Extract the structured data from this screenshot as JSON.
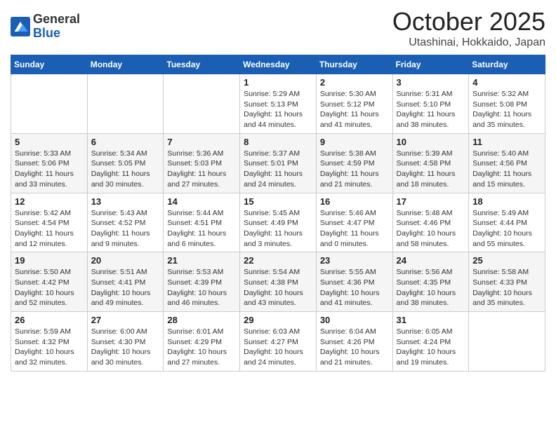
{
  "logo": {
    "general": "General",
    "blue": "Blue"
  },
  "title": "October 2025",
  "subtitle": "Utashinai, Hokkaido, Japan",
  "days_of_week": [
    "Sunday",
    "Monday",
    "Tuesday",
    "Wednesday",
    "Thursday",
    "Friday",
    "Saturday"
  ],
  "weeks": [
    [
      {
        "day": "",
        "info": ""
      },
      {
        "day": "",
        "info": ""
      },
      {
        "day": "",
        "info": ""
      },
      {
        "day": "1",
        "info": "Sunrise: 5:29 AM\nSunset: 5:13 PM\nDaylight: 11 hours\nand 44 minutes."
      },
      {
        "day": "2",
        "info": "Sunrise: 5:30 AM\nSunset: 5:12 PM\nDaylight: 11 hours\nand 41 minutes."
      },
      {
        "day": "3",
        "info": "Sunrise: 5:31 AM\nSunset: 5:10 PM\nDaylight: 11 hours\nand 38 minutes."
      },
      {
        "day": "4",
        "info": "Sunrise: 5:32 AM\nSunset: 5:08 PM\nDaylight: 11 hours\nand 35 minutes."
      }
    ],
    [
      {
        "day": "5",
        "info": "Sunrise: 5:33 AM\nSunset: 5:06 PM\nDaylight: 11 hours\nand 33 minutes."
      },
      {
        "day": "6",
        "info": "Sunrise: 5:34 AM\nSunset: 5:05 PM\nDaylight: 11 hours\nand 30 minutes."
      },
      {
        "day": "7",
        "info": "Sunrise: 5:36 AM\nSunset: 5:03 PM\nDaylight: 11 hours\nand 27 minutes."
      },
      {
        "day": "8",
        "info": "Sunrise: 5:37 AM\nSunset: 5:01 PM\nDaylight: 11 hours\nand 24 minutes."
      },
      {
        "day": "9",
        "info": "Sunrise: 5:38 AM\nSunset: 4:59 PM\nDaylight: 11 hours\nand 21 minutes."
      },
      {
        "day": "10",
        "info": "Sunrise: 5:39 AM\nSunset: 4:58 PM\nDaylight: 11 hours\nand 18 minutes."
      },
      {
        "day": "11",
        "info": "Sunrise: 5:40 AM\nSunset: 4:56 PM\nDaylight: 11 hours\nand 15 minutes."
      }
    ],
    [
      {
        "day": "12",
        "info": "Sunrise: 5:42 AM\nSunset: 4:54 PM\nDaylight: 11 hours\nand 12 minutes."
      },
      {
        "day": "13",
        "info": "Sunrise: 5:43 AM\nSunset: 4:52 PM\nDaylight: 11 hours\nand 9 minutes."
      },
      {
        "day": "14",
        "info": "Sunrise: 5:44 AM\nSunset: 4:51 PM\nDaylight: 11 hours\nand 6 minutes."
      },
      {
        "day": "15",
        "info": "Sunrise: 5:45 AM\nSunset: 4:49 PM\nDaylight: 11 hours\nand 3 minutes."
      },
      {
        "day": "16",
        "info": "Sunrise: 5:46 AM\nSunset: 4:47 PM\nDaylight: 11 hours\nand 0 minutes."
      },
      {
        "day": "17",
        "info": "Sunrise: 5:48 AM\nSunset: 4:46 PM\nDaylight: 10 hours\nand 58 minutes."
      },
      {
        "day": "18",
        "info": "Sunrise: 5:49 AM\nSunset: 4:44 PM\nDaylight: 10 hours\nand 55 minutes."
      }
    ],
    [
      {
        "day": "19",
        "info": "Sunrise: 5:50 AM\nSunset: 4:42 PM\nDaylight: 10 hours\nand 52 minutes."
      },
      {
        "day": "20",
        "info": "Sunrise: 5:51 AM\nSunset: 4:41 PM\nDaylight: 10 hours\nand 49 minutes."
      },
      {
        "day": "21",
        "info": "Sunrise: 5:53 AM\nSunset: 4:39 PM\nDaylight: 10 hours\nand 46 minutes."
      },
      {
        "day": "22",
        "info": "Sunrise: 5:54 AM\nSunset: 4:38 PM\nDaylight: 10 hours\nand 43 minutes."
      },
      {
        "day": "23",
        "info": "Sunrise: 5:55 AM\nSunset: 4:36 PM\nDaylight: 10 hours\nand 41 minutes."
      },
      {
        "day": "24",
        "info": "Sunrise: 5:56 AM\nSunset: 4:35 PM\nDaylight: 10 hours\nand 38 minutes."
      },
      {
        "day": "25",
        "info": "Sunrise: 5:58 AM\nSunset: 4:33 PM\nDaylight: 10 hours\nand 35 minutes."
      }
    ],
    [
      {
        "day": "26",
        "info": "Sunrise: 5:59 AM\nSunset: 4:32 PM\nDaylight: 10 hours\nand 32 minutes."
      },
      {
        "day": "27",
        "info": "Sunrise: 6:00 AM\nSunset: 4:30 PM\nDaylight: 10 hours\nand 30 minutes."
      },
      {
        "day": "28",
        "info": "Sunrise: 6:01 AM\nSunset: 4:29 PM\nDaylight: 10 hours\nand 27 minutes."
      },
      {
        "day": "29",
        "info": "Sunrise: 6:03 AM\nSunset: 4:27 PM\nDaylight: 10 hours\nand 24 minutes."
      },
      {
        "day": "30",
        "info": "Sunrise: 6:04 AM\nSunset: 4:26 PM\nDaylight: 10 hours\nand 21 minutes."
      },
      {
        "day": "31",
        "info": "Sunrise: 6:05 AM\nSunset: 4:24 PM\nDaylight: 10 hours\nand 19 minutes."
      },
      {
        "day": "",
        "info": ""
      }
    ]
  ]
}
